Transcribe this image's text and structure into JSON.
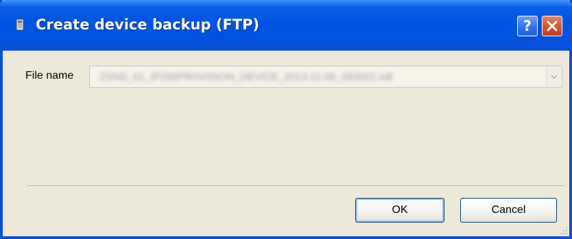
{
  "window": {
    "title": "Create device backup (FTP)",
    "title_icon": "device-icon",
    "help_button_glyph": "?",
    "close_button_icon": "close-icon"
  },
  "form": {
    "file_name_label": "File name",
    "file_name_value": "ZSND_01_IP200PROVISION_DEVICE_2013-11-06_093022.sdt",
    "dropdown_icon": "chevron-down-icon"
  },
  "buttons": {
    "ok_label": "OK",
    "cancel_label": "Cancel"
  },
  "colors": {
    "titlebar": "#0054e3",
    "dialog_background": "#ece9d8",
    "close_button": "#d4502c",
    "button_border": "#003c74"
  }
}
